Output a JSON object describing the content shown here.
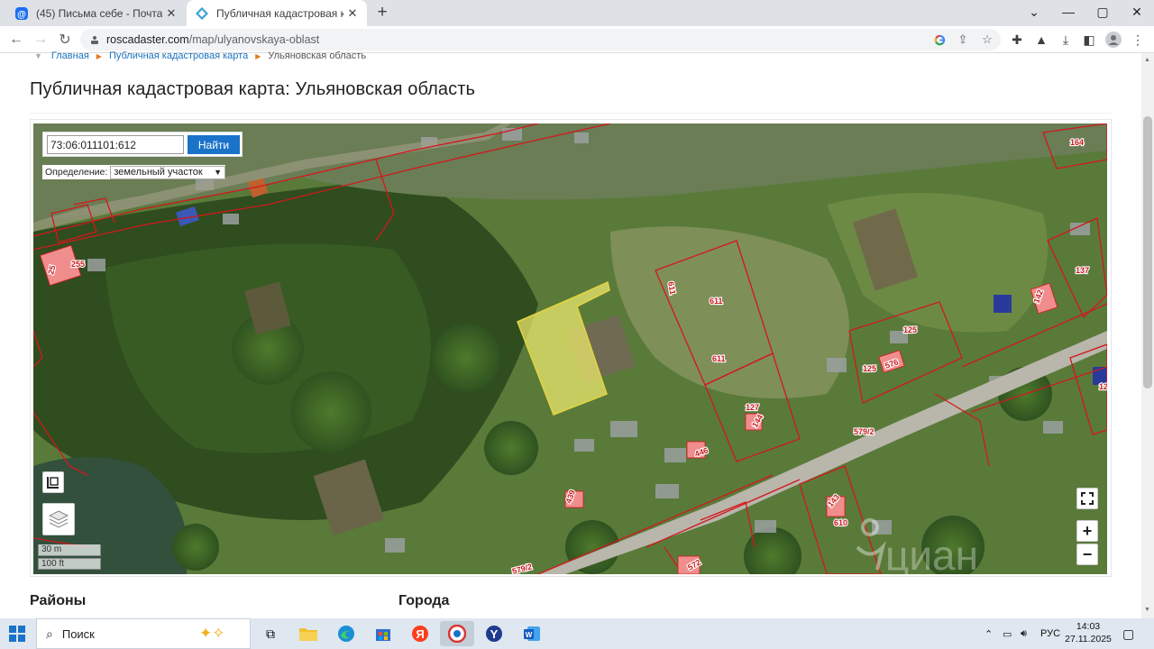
{
  "browser": {
    "tabs": [
      {
        "title": "(45) Письма себе - Почта Mail",
        "active": false
      },
      {
        "title": "Публичная кадастровая карта: У",
        "active": true
      }
    ],
    "url_host": "roscadaster.com",
    "url_path": "/map/ulyanovskaya-oblast"
  },
  "breadcrumb": {
    "items": [
      "Главная",
      "Публичная кадастровая карта",
      "Ульяновская область"
    ]
  },
  "page": {
    "title": "Публичная кадастровая карта: Ульяновская область"
  },
  "map": {
    "search_value": "73:06:011101:612",
    "search_button": "Найти",
    "definition_label": "Определение:",
    "definition_value": "земельный участок",
    "scale_metric": "30 m",
    "scale_imperial": "100 ft",
    "zoom_in": "+",
    "zoom_out": "−",
    "parcel_labels": {
      "l164": "164",
      "l255": "255",
      "l25": "25",
      "l137": "137",
      "l611a": "611",
      "l611b": "611",
      "l611c": "611",
      "l125a": "125",
      "l125b": "125",
      "l576": "576",
      "l127": "127",
      "l144": "144",
      "l446": "446",
      "l579a": "579/2",
      "l579b": "579/2",
      "l610": "610",
      "l439": "439",
      "l142": "142",
      "l12": "12",
      "l572": "572",
      "l143": "143"
    },
    "watermark": "циан"
  },
  "sections": {
    "districts": "Районы",
    "cities": "Города"
  },
  "taskbar": {
    "search_label": "Поиск",
    "lang": "РУС",
    "time": "14:03",
    "date": "27.11.2025"
  },
  "colors": {
    "parcel_border": "#d2181c",
    "building_fill": "#f08d8d",
    "selected_parcel": "#f0ec6e",
    "link": "#1e73be",
    "button": "#1a73c9"
  }
}
